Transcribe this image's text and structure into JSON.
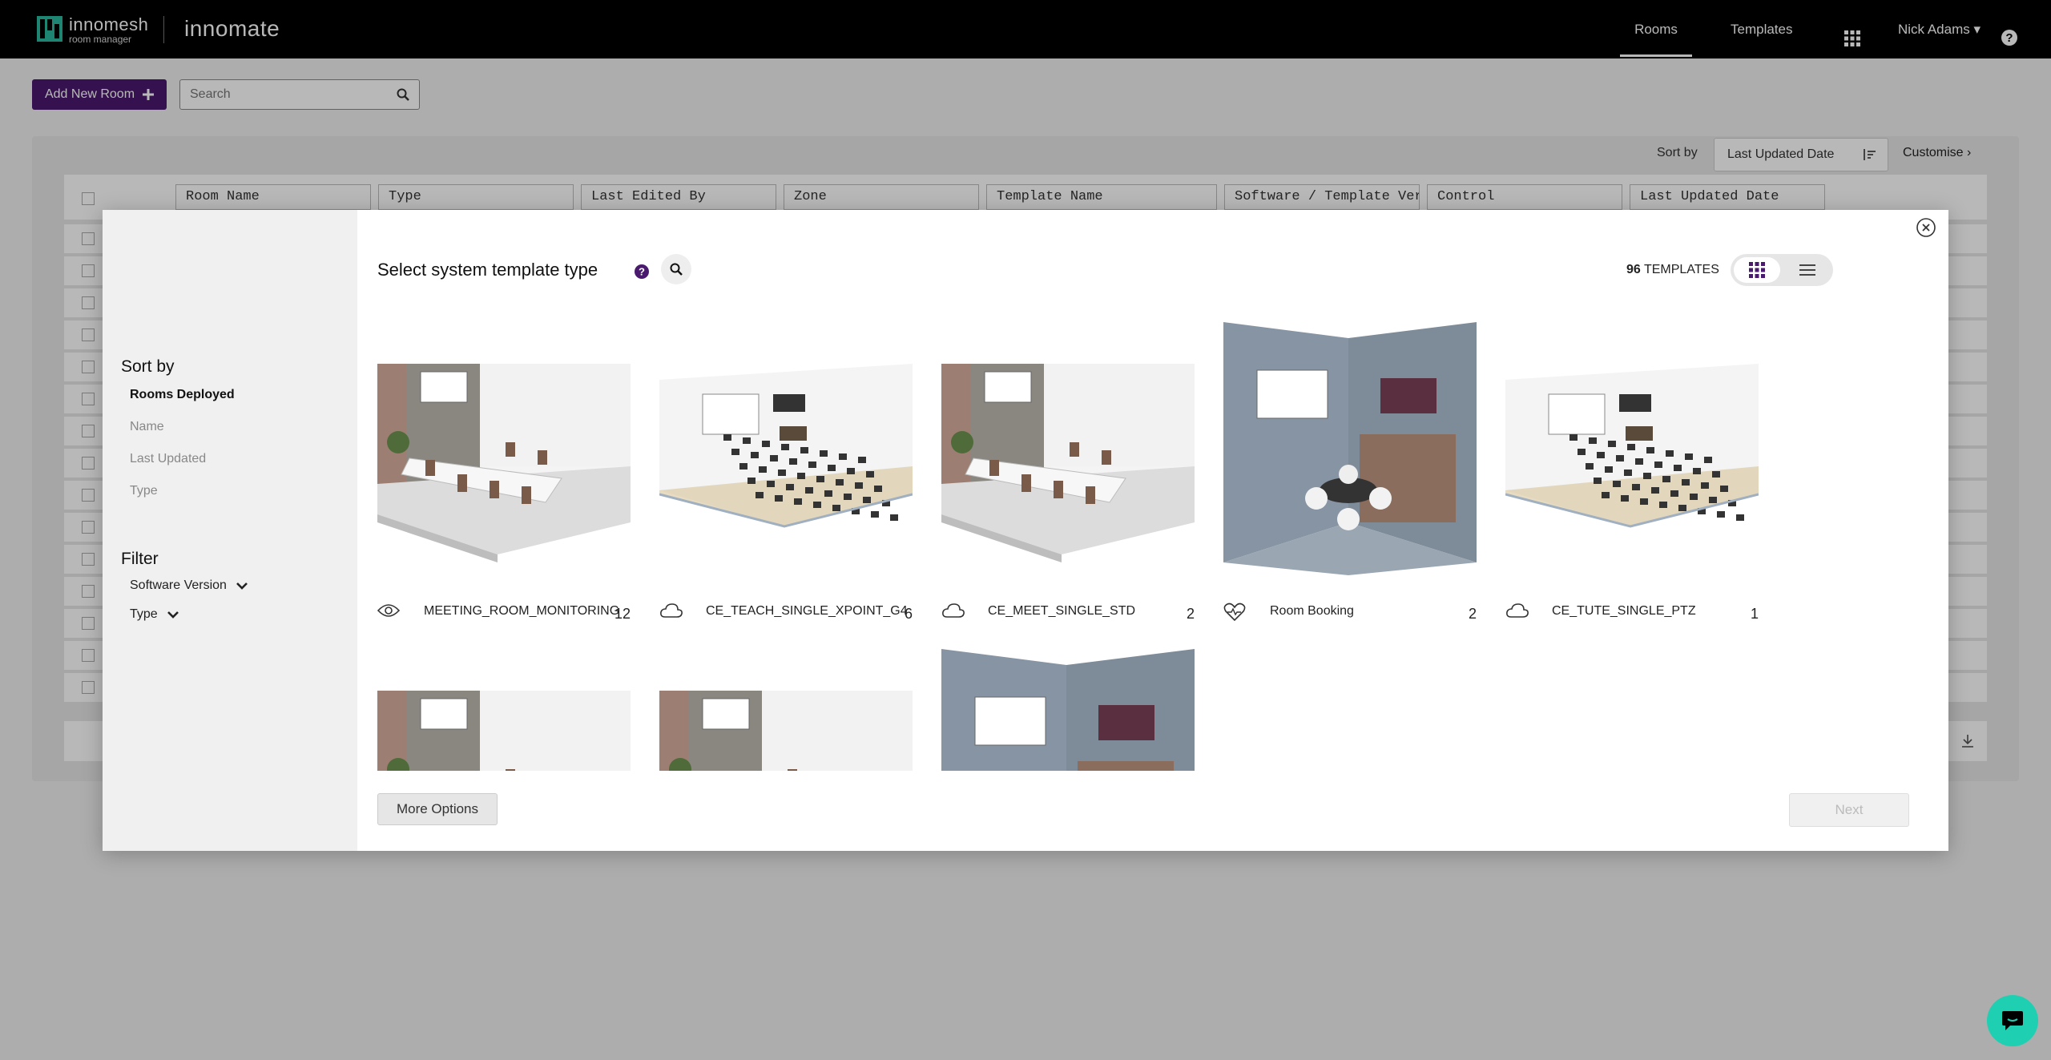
{
  "brand": {
    "logo_line1": "innomesh",
    "logo_line2": "room manager",
    "app_name": "innomate"
  },
  "nav": {
    "rooms": "Rooms",
    "templates": "Templates",
    "user": "Nick Adams ▾"
  },
  "toolbar": {
    "add_room": "Add New Room",
    "search_placeholder": "Search"
  },
  "table": {
    "sort_by_label": "Sort by",
    "sort_by_value": "Last Updated Date",
    "customise": "Customise ›",
    "columns": [
      "Room Name",
      "Type",
      "Last Edited By",
      "Zone",
      "Template Name",
      "Software / Template Ver",
      "Control",
      "Last Updated Date"
    ]
  },
  "modal": {
    "title": "Select system template type",
    "count_number": "96",
    "count_label": "TEMPLATES",
    "sort_heading": "Sort by",
    "sort_options": [
      "Rooms Deployed",
      "Name",
      "Last Updated",
      "Type"
    ],
    "filter_heading": "Filter",
    "filters": [
      "Software Version",
      "Type"
    ],
    "more_options": "More Options",
    "next": "Next",
    "templates": [
      {
        "name": "MEETING_ROOM_MONITORING",
        "count": "12",
        "icon": "eye-icon",
        "scene": "meeting"
      },
      {
        "name": "CE_TEACH_SINGLE_XPOINT_G4",
        "count": "6",
        "icon": "cloud-icon",
        "scene": "classroom"
      },
      {
        "name": "CE_MEET_SINGLE_STD",
        "count": "2",
        "icon": "cloud-icon",
        "scene": "meeting"
      },
      {
        "name": "Room Booking",
        "count": "2",
        "icon": "heart-pulse-icon",
        "scene": "booking"
      },
      {
        "name": "CE_TUTE_SINGLE_PTZ",
        "count": "1",
        "icon": "cloud-icon",
        "scene": "classroom"
      }
    ]
  },
  "colors": {
    "primary": "#4a1a6e",
    "chat": "#1ecfb2"
  }
}
